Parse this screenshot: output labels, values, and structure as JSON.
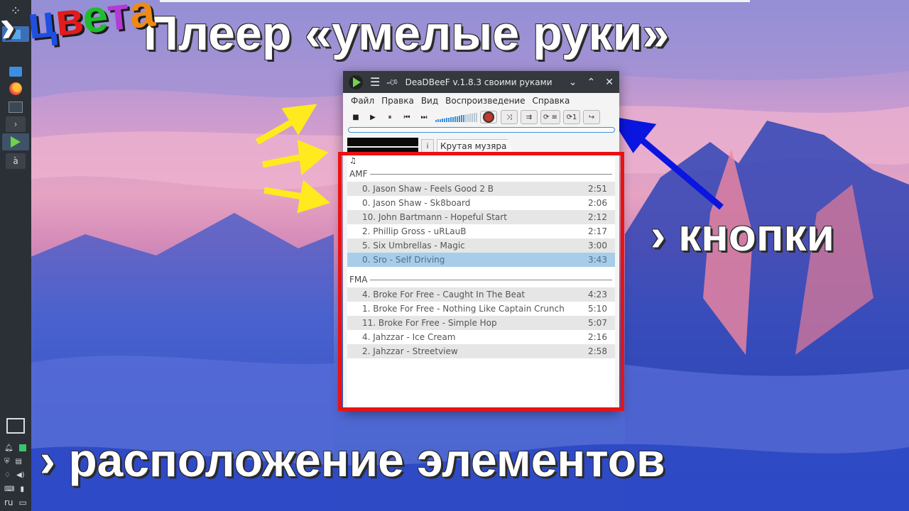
{
  "captions": {
    "title": "Плеер «умелые руки»",
    "colors_marker": "›",
    "colors_letters": [
      {
        "ch": "ц",
        "color": "#1f4fe0"
      },
      {
        "ch": "в",
        "color": "#e21b1b"
      },
      {
        "ch": "е",
        "color": "#1fbd2c"
      },
      {
        "ch": "т",
        "color": "#b23bd6"
      },
      {
        "ch": "а",
        "color": "#f08a12"
      }
    ],
    "buttons": "› кнопки",
    "layout": "› расположение элементов"
  },
  "taskbar": {
    "terminal_glyph": "›",
    "a_glyph": "à",
    "language": "ru"
  },
  "window": {
    "title": "DeaDBeeF v.1.8.3 своими руками",
    "menu": [
      "Файл",
      "Правка",
      "Вид",
      "Воспроизведение",
      "Справка"
    ],
    "toolbar": {
      "stop": "■",
      "play": "▶",
      "pause": "⏸",
      "prev": "⏮",
      "next": "⏭",
      "volume_level": 0.7,
      "shuffle": "⤨",
      "order": "⇉",
      "repeat": "⟳ ≡",
      "repeat_one": "⟳1",
      "cursor_follows": "↪"
    },
    "info_label": "i",
    "tab_label": "Крутая музяра",
    "note_glyph": "♫",
    "groups": [
      {
        "name": "AMF",
        "tracks": [
          {
            "title": "0. Jason Shaw - Feels Good 2 B",
            "duration": "2:51"
          },
          {
            "title": "0. Jason Shaw - Sk8board",
            "duration": "2:06"
          },
          {
            "title": "10. John Bartmann - Hopeful Start",
            "duration": "2:12"
          },
          {
            "title": "2. Phillip Gross - uRLauB",
            "duration": "2:17"
          },
          {
            "title": "5. Six Umbrellas - Magic",
            "duration": "3:00"
          },
          {
            "title": "0. Sro - Self Driving",
            "duration": "3:43",
            "selected": true
          }
        ]
      },
      {
        "name": "FMA",
        "tracks": [
          {
            "title": "4. Broke For Free - Caught In The Beat",
            "duration": "4:23"
          },
          {
            "title": "1. Broke For Free - Nothing Like Captain Crunch",
            "duration": "5:10"
          },
          {
            "title": "11. Broke For Free - Simple Hop",
            "duration": "5:07"
          },
          {
            "title": "4. Jahzzar - Ice Cream",
            "duration": "2:16"
          },
          {
            "title": "2. Jahzzar - Streetview",
            "duration": "2:58"
          }
        ]
      }
    ]
  },
  "colors": {
    "highlight_frame": "#ec1111",
    "arrow_yellow": "#ffea1f",
    "arrow_blue": "#0a16e0",
    "selection": "#a8cde9",
    "accent": "#3d8fd8"
  }
}
